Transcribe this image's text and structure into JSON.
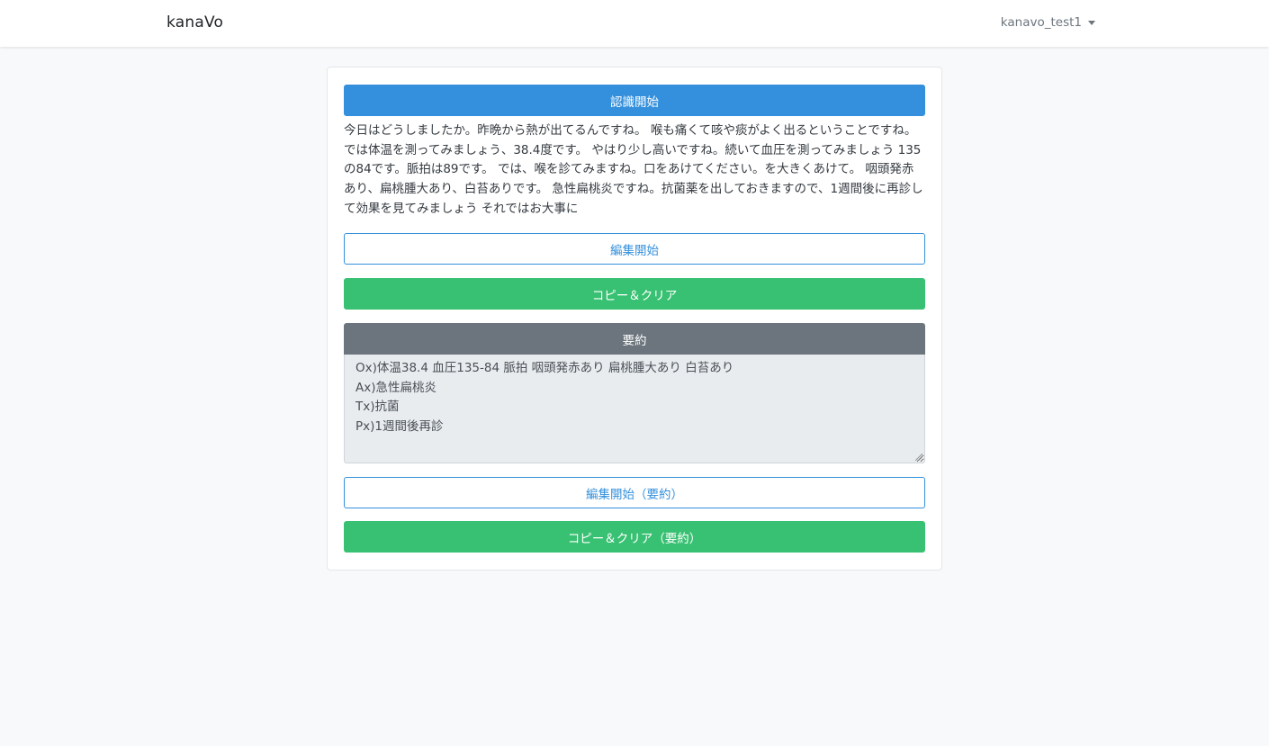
{
  "navbar": {
    "brand": "kanaVo",
    "user": "kanavo_test1"
  },
  "card": {
    "start_recognition": "認識開始",
    "transcript": "今日はどうしましたか。昨晩から熱が出てるんですね。 喉も痛くて咳や痰がよく出るということですね。 では体温を測ってみましょう、38.4度です。 やはり少し高いですね。続いて血圧を測ってみましょう 135の84です。脈拍は89です。 では、喉を診てみますね。口をあけてください。を大きくあけて。 咽頭発赤あり、扁桃腫大あり、白苔ありです。 急性扁桃炎ですね。抗菌薬を出しておきますので、1週間後に再診して効果を見てみましょう それではお大事に",
    "edit_start": "編集開始",
    "copy_clear": "コピー＆クリア",
    "summary_header": "要約",
    "summary_lines": [
      "Ox)体温38.4 血圧135-84 脈拍 咽頭発赤あり 扁桃腫大あり 白苔あり",
      "Ax)急性扁桃炎",
      "Tx)抗菌",
      "Px)1週間後再診"
    ],
    "edit_start_summary": "編集開始（要約）",
    "copy_clear_summary": "コピー＆クリア（要約）"
  },
  "colors": {
    "primary": "#3490dc",
    "success": "#38c172",
    "secondary": "#6c757d",
    "background": "#f8f9fa"
  }
}
